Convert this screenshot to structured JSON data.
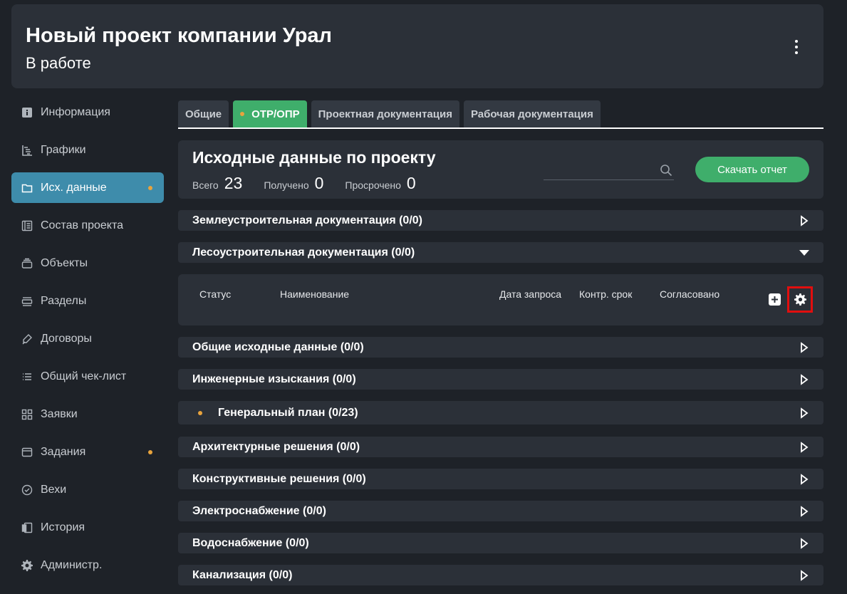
{
  "header": {
    "title": "Новый проект компании Урал",
    "status": "В работе",
    "menu_icon": "kebab-menu-icon"
  },
  "sidebar": {
    "items": [
      {
        "label": "Информация",
        "icon": "info-icon",
        "active": false,
        "has_dot": false
      },
      {
        "label": "Графики",
        "icon": "gantt-icon",
        "active": false,
        "has_dot": false
      },
      {
        "label": "Исх. данные",
        "icon": "folder-icon",
        "active": true,
        "has_dot": true
      },
      {
        "label": "Состав проекта",
        "icon": "book-icon",
        "active": false,
        "has_dot": false
      },
      {
        "label": "Объекты",
        "icon": "stack-icon",
        "active": false,
        "has_dot": false
      },
      {
        "label": "Разделы",
        "icon": "sections-icon",
        "active": false,
        "has_dot": false
      },
      {
        "label": "Договоры",
        "icon": "pen-icon",
        "active": false,
        "has_dot": false
      },
      {
        "label": "Общий чек-лист",
        "icon": "list-icon",
        "active": false,
        "has_dot": false
      },
      {
        "label": "Заявки",
        "icon": "grid-icon",
        "active": false,
        "has_dot": false
      },
      {
        "label": "Задания",
        "icon": "tasks-icon",
        "active": false,
        "has_dot": true
      },
      {
        "label": "Вехи",
        "icon": "check-circle-icon",
        "active": false,
        "has_dot": false
      },
      {
        "label": "История",
        "icon": "history-icon",
        "active": false,
        "has_dot": false
      },
      {
        "label": "Администр.",
        "icon": "gear-icon",
        "active": false,
        "has_dot": false
      }
    ]
  },
  "tabs": [
    {
      "label": "Общие",
      "active": false
    },
    {
      "label": "ОТР/ОПР",
      "active": true
    },
    {
      "label": "Проектная документация",
      "active": false
    },
    {
      "label": "Рабочая документация",
      "active": false
    }
  ],
  "summary": {
    "title": "Исходные данные по проекту",
    "total_label": "Всего",
    "total_value": "23",
    "received_label": "Получено",
    "received_value": "0",
    "overdue_label": "Просрочено",
    "overdue_value": "0",
    "search_value": "",
    "download_label": "Скачать отчет"
  },
  "sections": [
    {
      "title": "Землеустроительная документация (0/0)",
      "expanded": false,
      "has_dot": false
    },
    {
      "title": "Лесоустроительная документация (0/0)",
      "expanded": true,
      "has_dot": false
    },
    {
      "title": "Общие исходные данные (0/0)",
      "expanded": false,
      "has_dot": false
    },
    {
      "title": "Инженерные изыскания (0/0)",
      "expanded": false,
      "has_dot": false
    },
    {
      "title": "Генеральный план (0/23)",
      "expanded": false,
      "has_dot": true
    },
    {
      "title": "Архитектурные решения (0/0)",
      "expanded": false,
      "has_dot": false
    },
    {
      "title": "Конструктивные решения (0/0)",
      "expanded": false,
      "has_dot": false
    },
    {
      "title": "Электроснабжение (0/0)",
      "expanded": false,
      "has_dot": false
    },
    {
      "title": "Водоснабжение (0/0)",
      "expanded": false,
      "has_dot": false
    },
    {
      "title": "Канализация (0/0)",
      "expanded": false,
      "has_dot": false
    }
  ],
  "table": {
    "columns": [
      "Статус",
      "Наименование",
      "Дата запроса",
      "Контр. срок",
      "Согласовано"
    ],
    "add_icon": "plus-icon",
    "settings_icon": "gear-icon"
  },
  "colors": {
    "accent_green": "#3fae6b",
    "active_blue": "#3e8cab",
    "notice_orange": "#e8a33d",
    "highlight_red": "#e10e0e"
  }
}
